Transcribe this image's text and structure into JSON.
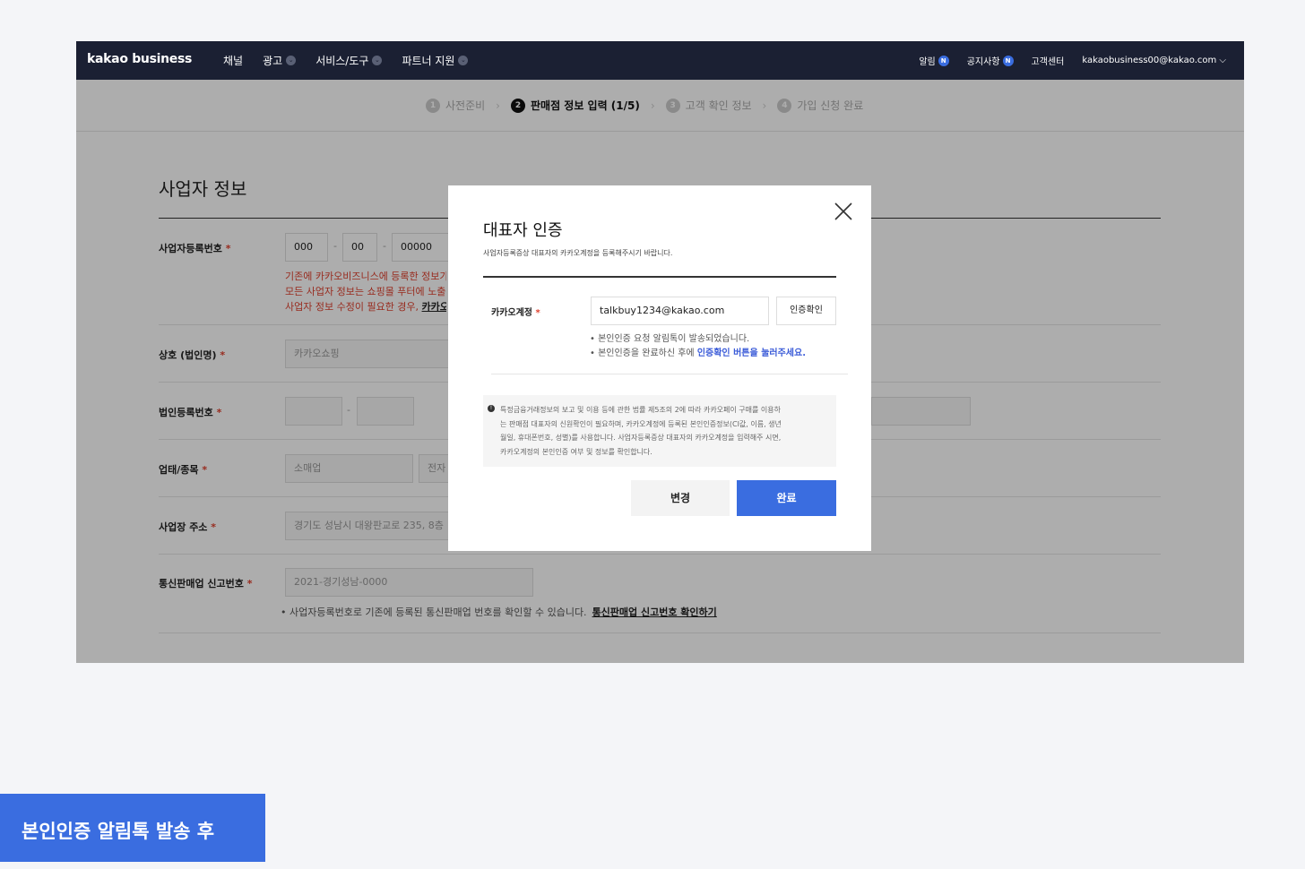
{
  "nav": {
    "logo": "kakao business",
    "menu": [
      "채널",
      "광고",
      "서비스/도구",
      "파트너 지원"
    ],
    "right": {
      "alarm": "알림",
      "notice": "공지사항",
      "badge": "N",
      "support": "고객센터",
      "account": "kakaobusiness00@kakao.com ⌵"
    }
  },
  "steps": [
    {
      "num": "1",
      "label": "사전준비"
    },
    {
      "num": "2",
      "label": "판매점 정보 입력 (1/5)"
    },
    {
      "num": "3",
      "label": "고객 확인 정보"
    },
    {
      "num": "4",
      "label": "가입 신청 완료"
    }
  ],
  "form": {
    "title": "사업자 정보",
    "req_mark": "*",
    "biz_no_label": "사업자등록번호",
    "biz_no": [
      "000",
      "00",
      "00000"
    ],
    "warn_lines": [
      "기존에 카카오비즈니스에 등록한 정보가",
      "모든 사업자 정보는 쇼핑몰 푸터에 노출된",
      "사업자 정보 수정이 필요한 경우, "
    ],
    "warn_link": "카카오비",
    "company_label": "상호 (법인명)",
    "company_value": "카카오쇼핑",
    "corp_no_label": "법인등록번호",
    "category_label": "업태/종목",
    "category_value": "소매업",
    "category_value2": "전자",
    "address_label": "사업장 주소",
    "address_value": "경기도 성남시 대왕판교로 235, 8층",
    "ecom_label": "통신판매업 신고번호",
    "ecom_value": "2021-경기성남-0000",
    "ecom_hint": "• 사업자등록번호로 기존에 등록된 통신판매업 번호를 확인할 수 있습니다.",
    "ecom_link": "통신판매업 신고번호 확인하기"
  },
  "modal": {
    "title": "대표자 인증",
    "subtitle": "사업자등록증상 대표자의 카카오계정을 등록해주시기 바랍니다.",
    "account_label": "카카오계정",
    "account_value": "talkbuy1234@kakao.com",
    "verify_button": "인증확인",
    "note1": "• 본인인증 요청 알림톡이 발송되었습니다.",
    "note2_prefix": "• 본인인증을 완료하신 후에 ",
    "note2_link": "인증확인 버튼을 눌러주세요.",
    "info_icon": "!",
    "info_lines": [
      "특정금융거래정보의 보고 및 이용 등에 관한 법률 제5조의 2에 따라 카카오페이 구매를 이용하",
      "는 판매점 대표자의 신원확인이 필요하며, 카카오계정에 등록된 본인인증정보(CI값, 이름, 생년",
      "월일, 휴대폰번호, 성별)를 사용합니다. 사업자등록증상 대표자의 카카오계정을 입력해주 시면,",
      "카카오계정의 본인인증 여부 및 정보를 확인합니다."
    ],
    "change_button": "변경",
    "done_button": "완료"
  },
  "caption": "본인인증 알림톡 발송 후"
}
